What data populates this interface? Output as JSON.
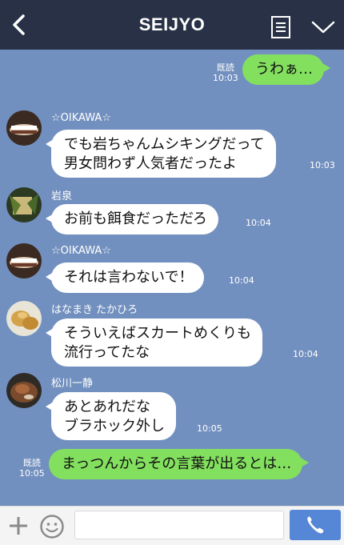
{
  "header": {
    "title": "SEIJYO",
    "back_icon": "chevron-left-icon",
    "menu_icon": "note-list-icon",
    "expand_icon": "chevron-down-icon",
    "background": "#283146"
  },
  "chat": {
    "background": "#7290bf",
    "messages": [
      {
        "from": "me",
        "text": "うわぁ…",
        "read": "既読",
        "time": "10:03"
      },
      {
        "from": "☆OIKAWA☆",
        "text": "でも岩ちゃんムシキングだって\n男女問わず人気者だったよ",
        "time": "10:03"
      },
      {
        "from": "岩泉",
        "text": "お前も餌食だっただろ",
        "time": "10:04"
      },
      {
        "from": "☆OIKAWA☆",
        "text": "それは言わないで！",
        "time": "10:04"
      },
      {
        "from": "はなまき たかひろ",
        "text": "そういえばスカートめくりも\n流行ってたな",
        "time": "10:04"
      },
      {
        "from": "松川一静",
        "text": "あとあれだな\nブラホック外し",
        "time": "10:05"
      },
      {
        "from": "me",
        "text": "まっつんからその言葉が出るとは…",
        "read": "既読",
        "time": "10:05"
      }
    ]
  },
  "input": {
    "plus_icon": "plus-icon",
    "emoji_icon": "smiley-icon",
    "send_icon": "phone-icon",
    "send_color": "#5587d6"
  },
  "colors": {
    "outgoing_bubble": "#83e05f",
    "incoming_bubble": "#ffffff"
  }
}
